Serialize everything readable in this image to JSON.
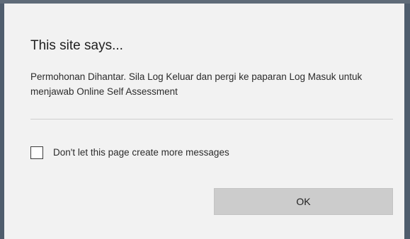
{
  "dialog": {
    "title": "This site says...",
    "message": "Permohonan Dihantar. Sila Log Keluar dan pergi ke paparan Log Masuk untuk menjawab Online Self Assessment",
    "checkbox": {
      "label": "Don't let this page create more messages",
      "checked": false
    },
    "ok_label": "OK"
  },
  "colors": {
    "background": "#f2f2f2",
    "frame": "#4f5d6d",
    "button": "#cccccc"
  }
}
